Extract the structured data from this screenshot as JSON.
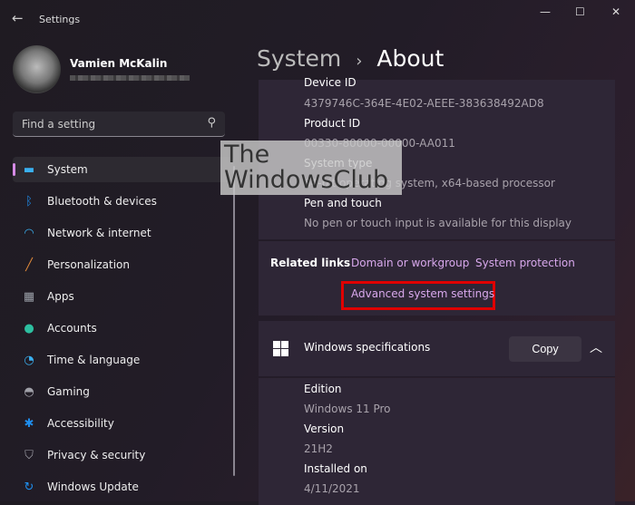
{
  "window": {
    "title": "Settings",
    "minimize": "—",
    "maximize": "☐",
    "close": "✕"
  },
  "user": {
    "name": "Vamien McKalin"
  },
  "search": {
    "placeholder": "Find a setting"
  },
  "nav": [
    {
      "label": "System",
      "icon": "display-icon",
      "color": "#3ab0f0"
    },
    {
      "label": "Bluetooth & devices",
      "icon": "bluetooth-icon",
      "color": "#1f8ff0"
    },
    {
      "label": "Network & internet",
      "icon": "wifi-icon",
      "color": "#3ab0f0"
    },
    {
      "label": "Personalization",
      "icon": "brush-icon",
      "color": "#e08a3a"
    },
    {
      "label": "Apps",
      "icon": "apps-icon",
      "color": "#9aa0a8"
    },
    {
      "label": "Accounts",
      "icon": "person-icon",
      "color": "#2dbfa0"
    },
    {
      "label": "Time & language",
      "icon": "globe-clock-icon",
      "color": "#3ab0f0"
    },
    {
      "label": "Gaming",
      "icon": "gamepad-icon",
      "color": "#a0a0a8"
    },
    {
      "label": "Accessibility",
      "icon": "accessibility-icon",
      "color": "#1f8ff0"
    },
    {
      "label": "Privacy & security",
      "icon": "shield-icon",
      "color": "#a0a0a8"
    },
    {
      "label": "Windows Update",
      "icon": "update-icon",
      "color": "#1f8ff0"
    }
  ],
  "breadcrumb": {
    "parent": "System",
    "sep": "›",
    "current": "About"
  },
  "device_specs": [
    {
      "key": "Device ID",
      "value": "4379746C-364E-4E02-AEEE-383638492AD8"
    },
    {
      "key": "Product ID",
      "value": "00330-80000-00000-AA011"
    },
    {
      "key": "System type",
      "value": "64-bit operating system, x64-based processor"
    },
    {
      "key": "Pen and touch",
      "value": "No pen or touch input is available for this display"
    }
  ],
  "related": {
    "label": "Related links",
    "links": [
      "Domain or workgroup",
      "System protection",
      "Advanced system settings"
    ],
    "highlight_color": "#e00000"
  },
  "winspec": {
    "title": "Windows specifications",
    "copy": "Copy",
    "items": [
      {
        "key": "Edition",
        "value": "Windows 11 Pro"
      },
      {
        "key": "Version",
        "value": "21H2"
      },
      {
        "key": "Installed on",
        "value": "4/11/2021"
      }
    ]
  },
  "watermark": {
    "line1": "The",
    "line2": "WindowsClub"
  }
}
